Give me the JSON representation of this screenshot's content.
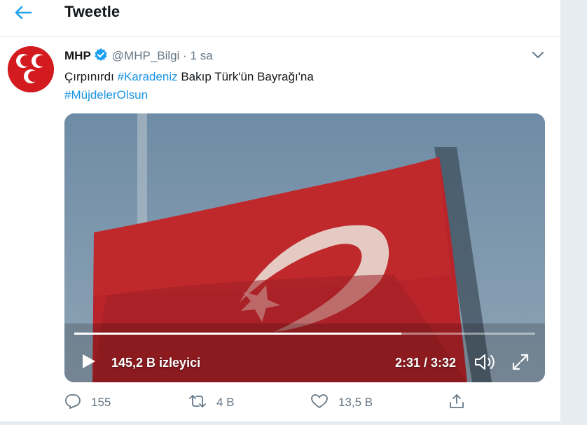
{
  "header": {
    "title": "Tweetle",
    "back_icon": "arrow-left-icon"
  },
  "tweet": {
    "name": "MHP",
    "handle": "@MHP_Bilgi",
    "separator": "·",
    "time": "1 sa",
    "text_part1": "Çırpınırdı ",
    "hashtag1": "#Karadeniz",
    "text_part2": " Bakıp Türk'ün Bayrağı'na",
    "hashtag2": "#MüjdelerOlsun",
    "avatar_logo": "mhp-crescents-logo"
  },
  "video": {
    "views": "145,2 B izleyici",
    "timecode": "2:31 / 3:32",
    "progress": 0.71
  },
  "actions": {
    "replies": "155",
    "retweets": "4 B",
    "likes": "13,5 B"
  },
  "colors": {
    "accent": "#1da1f2",
    "hashtag": "#1b95e0",
    "muted": "#657786",
    "logo_red": "#d21a1f"
  }
}
